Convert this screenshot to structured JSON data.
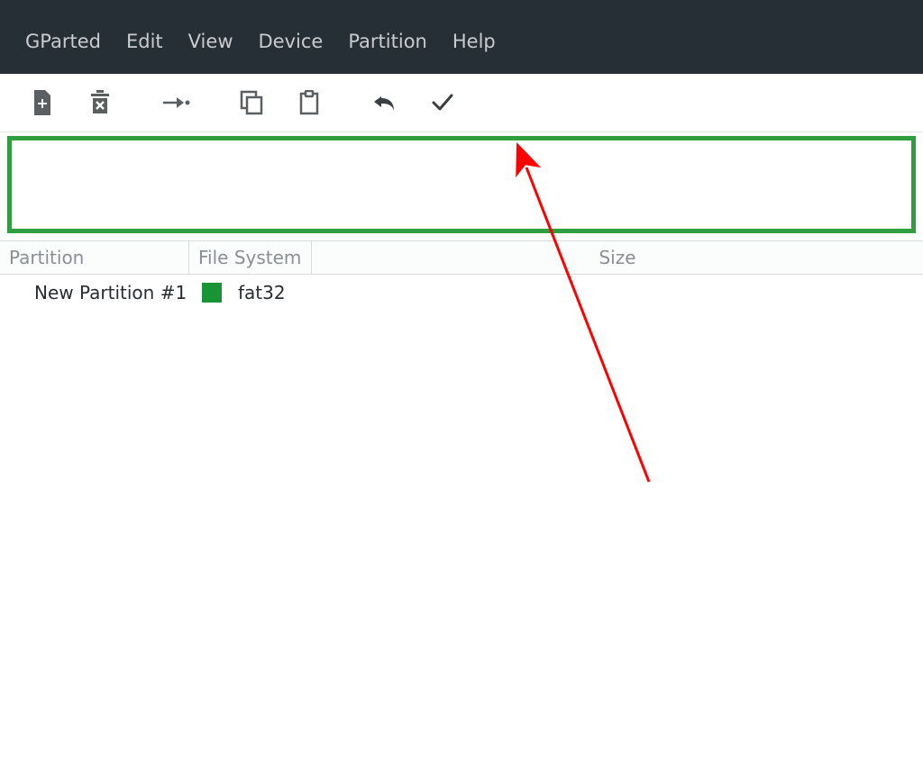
{
  "menubar": {
    "items": [
      "GParted",
      "Edit",
      "View",
      "Device",
      "Partition",
      "Help"
    ]
  },
  "toolbar": {
    "new_label": "New",
    "delete_label": "Delete",
    "resize_label": "Resize/Move",
    "copy_label": "Copy",
    "paste_label": "Paste",
    "undo_label": "Undo",
    "apply_label": "Apply"
  },
  "partition_graph": {
    "border_color": "#2e9e3f"
  },
  "list": {
    "headers": {
      "partition": "Partition",
      "filesystem": "File System",
      "size": "Size"
    },
    "rows": [
      {
        "partition": "New Partition #1",
        "fs_color": "#199435",
        "fs_label": "fat32"
      }
    ]
  },
  "annotation": {
    "type": "arrow",
    "color": "#ff0000"
  }
}
